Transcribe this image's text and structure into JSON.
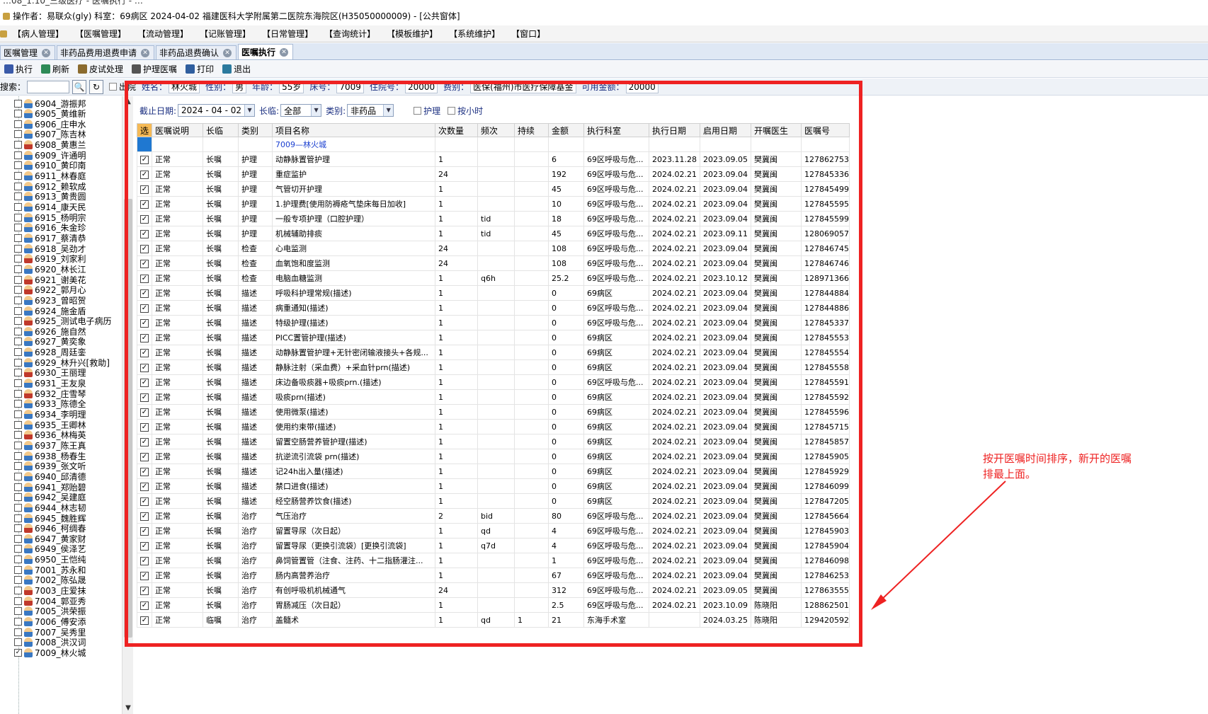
{
  "window": {
    "title_fragment": "…08_1.10_三级医疗 - 医嘱执行 - …",
    "operator_line": "操作者：易联众(gly)  科室：69病区  2024-04-02  福建医科大学附属第二医院东海院区(H35050000009) - [公共窗体]"
  },
  "menu": [
    "【病人管理】",
    "【医嘱管理】",
    "【流动管理】",
    "【记账管理】",
    "【日常管理】",
    "【查询统计】",
    "【模板维护】",
    "【系统维护】",
    "【窗口】"
  ],
  "tabs": [
    {
      "label": "医嘱管理",
      "active": false
    },
    {
      "label": "非药品费用退费申请",
      "active": false
    },
    {
      "label": "非药品退费确认",
      "active": false
    },
    {
      "label": "医嘱执行",
      "active": true
    }
  ],
  "toolbar": [
    {
      "label": "执行",
      "icon": "execute-icon",
      "color": "#3a5aa8"
    },
    {
      "label": "刷新",
      "icon": "refresh-icon",
      "color": "#2e8b57"
    },
    {
      "label": "皮试处理",
      "icon": "syringe-icon",
      "color": "#8b6b2e"
    },
    {
      "label": "护理医嘱",
      "icon": "nursing-icon",
      "color": "#555555"
    },
    {
      "label": "打印",
      "icon": "printer-icon",
      "color": "#2f5e9e"
    },
    {
      "label": "退出",
      "icon": "exit-icon",
      "color": "#2c7a9e"
    }
  ],
  "patientbar": {
    "search_label": "搜索：",
    "discharge_label": "出院",
    "fields": [
      {
        "label": "姓名：",
        "value": "林火城"
      },
      {
        "label": "性别：",
        "value": "男"
      },
      {
        "label": "年龄：",
        "value": "55岁"
      },
      {
        "label": "床号：",
        "value": "7009"
      },
      {
        "label": "住院号：",
        "value": "20000"
      },
      {
        "label": "费别：",
        "value": "医保(福州)市医疗保障基金"
      },
      {
        "label": "可用金额：",
        "value": "20000"
      }
    ]
  },
  "patients": [
    {
      "id": "6904_游振邦",
      "female": false,
      "checked": false
    },
    {
      "id": "6905_黄维新",
      "female": false,
      "checked": false
    },
    {
      "id": "6906_庄申水",
      "female": false,
      "checked": false
    },
    {
      "id": "6907_陈吉林",
      "female": false,
      "checked": false
    },
    {
      "id": "6908_黄惠兰",
      "female": true,
      "checked": false
    },
    {
      "id": "6909_许通明",
      "female": false,
      "checked": false
    },
    {
      "id": "6910_黄印南",
      "female": false,
      "checked": false
    },
    {
      "id": "6911_林春庭",
      "female": false,
      "checked": false
    },
    {
      "id": "6912_赖软成",
      "female": false,
      "checked": false
    },
    {
      "id": "6913_黄贵圆",
      "female": false,
      "checked": false
    },
    {
      "id": "6914_康天民",
      "female": false,
      "checked": false
    },
    {
      "id": "6915_杨明宗",
      "female": false,
      "checked": false
    },
    {
      "id": "6916_朱金珍",
      "female": false,
      "checked": false
    },
    {
      "id": "6917_蔡清恭",
      "female": false,
      "checked": false
    },
    {
      "id": "6918_吴劲才",
      "female": false,
      "checked": false
    },
    {
      "id": "6919_刘家利",
      "female": true,
      "checked": false
    },
    {
      "id": "6920_林长江",
      "female": false,
      "checked": false
    },
    {
      "id": "6921_谢美花",
      "female": true,
      "checked": false
    },
    {
      "id": "6922_郭月心",
      "female": true,
      "checked": false
    },
    {
      "id": "6923_曾昭贺",
      "female": false,
      "checked": false
    },
    {
      "id": "6924_施金盾",
      "female": false,
      "checked": false
    },
    {
      "id": "6925_测试电子病历",
      "female": true,
      "checked": false
    },
    {
      "id": "6926_施自然",
      "female": false,
      "checked": false
    },
    {
      "id": "6927_黄奕象",
      "female": false,
      "checked": false
    },
    {
      "id": "6928_周廷銮",
      "female": false,
      "checked": false
    },
    {
      "id": "6929_林升兴[救助]",
      "female": false,
      "checked": false
    },
    {
      "id": "6930_王丽理",
      "female": true,
      "checked": false
    },
    {
      "id": "6931_王友泉",
      "female": false,
      "checked": false
    },
    {
      "id": "6932_庄雪琴",
      "female": true,
      "checked": false
    },
    {
      "id": "6933_陈德全",
      "female": false,
      "checked": false
    },
    {
      "id": "6934_李明理",
      "female": false,
      "checked": false
    },
    {
      "id": "6935_王卿林",
      "female": false,
      "checked": false
    },
    {
      "id": "6936_林梅英",
      "female": true,
      "checked": false
    },
    {
      "id": "6937_陈王真",
      "female": false,
      "checked": false
    },
    {
      "id": "6938_杨春生",
      "female": false,
      "checked": false
    },
    {
      "id": "6939_张文听",
      "female": false,
      "checked": false
    },
    {
      "id": "6940_邱清德",
      "female": false,
      "checked": false
    },
    {
      "id": "6941_郑贻碧",
      "female": false,
      "checked": false
    },
    {
      "id": "6942_吴建庭",
      "female": false,
      "checked": false
    },
    {
      "id": "6944_林志韧",
      "female": false,
      "checked": false
    },
    {
      "id": "6945_魏胜辉",
      "female": false,
      "checked": false
    },
    {
      "id": "6946_柯绸春",
      "female": true,
      "checked": false
    },
    {
      "id": "6947_黄家财",
      "female": false,
      "checked": false
    },
    {
      "id": "6949_侯泽艺",
      "female": false,
      "checked": false
    },
    {
      "id": "6950_王恺纯",
      "female": false,
      "checked": false
    },
    {
      "id": "7001_苏永和",
      "female": false,
      "checked": false
    },
    {
      "id": "7002_陈弘晟",
      "female": false,
      "checked": false
    },
    {
      "id": "7003_庄爱抹",
      "female": true,
      "checked": false
    },
    {
      "id": "7004_郭亚秀",
      "female": true,
      "checked": false
    },
    {
      "id": "7005_洪荣振",
      "female": false,
      "checked": false
    },
    {
      "id": "7006_傅安添",
      "female": false,
      "checked": false
    },
    {
      "id": "7007_吴秀里",
      "female": false,
      "checked": false
    },
    {
      "id": "7008_洪汉词",
      "female": false,
      "checked": false
    },
    {
      "id": "7009_林火城",
      "female": false,
      "checked": true
    }
  ],
  "filters": {
    "end_date_label": "截止日期:",
    "end_date_value": "2024 - 04 - 02",
    "long_temp_label": "长临:",
    "long_temp_value": "全部",
    "category_label": "类别:",
    "category_value": "非药品",
    "nursing_label": "护理",
    "by_hour_label": "按小时"
  },
  "grid": {
    "headers": [
      "选",
      "医嘱说明",
      "长临",
      "类别",
      "项目名称",
      "次数量",
      "频次",
      "持续",
      "金额",
      "执行科室",
      "执行日期",
      "启用日期",
      "开嘱医生",
      "医嘱号"
    ],
    "group_label": "7009—林火城",
    "rows": [
      [
        "正常",
        "长嘱",
        "护理",
        "动静脉置管护理",
        "1",
        "",
        "",
        "6",
        "69区呼吸与危...",
        "2023.11.28",
        "2023.09.05",
        "樊冀闽",
        "127862753"
      ],
      [
        "正常",
        "长嘱",
        "护理",
        "重症监护",
        "24",
        "",
        "",
        "192",
        "69区呼吸与危...",
        "2024.02.21",
        "2023.09.04",
        "樊冀闽",
        "127845336"
      ],
      [
        "正常",
        "长嘱",
        "护理",
        "气管切开护理",
        "1",
        "",
        "",
        "45",
        "69区呼吸与危...",
        "2024.02.21",
        "2023.09.04",
        "樊冀闽",
        "127845499"
      ],
      [
        "正常",
        "长嘱",
        "护理",
        "1.护理费[使用防褥疮气垫床每日加收]",
        "1",
        "",
        "",
        "10",
        "69区呼吸与危...",
        "2024.02.21",
        "2023.09.04",
        "樊冀闽",
        "127845595"
      ],
      [
        "正常",
        "长嘱",
        "护理",
        "一般专项护理（口腔护理）",
        "1",
        "tid",
        "",
        "18",
        "69区呼吸与危...",
        "2024.02.21",
        "2023.09.04",
        "樊冀闽",
        "127845599"
      ],
      [
        "正常",
        "长嘱",
        "护理",
        "机械辅助排痰",
        "1",
        "tid",
        "",
        "45",
        "69区呼吸与危...",
        "2024.02.21",
        "2023.09.11",
        "樊冀闽",
        "128069057"
      ],
      [
        "正常",
        "长嘱",
        "检查",
        "心电监测",
        "24",
        "",
        "",
        "108",
        "69区呼吸与危...",
        "2024.02.21",
        "2023.09.04",
        "樊冀闽",
        "127846745"
      ],
      [
        "正常",
        "长嘱",
        "检查",
        "血氧饱和度监测",
        "24",
        "",
        "",
        "108",
        "69区呼吸与危...",
        "2024.02.21",
        "2023.09.04",
        "樊冀闽",
        "127846746"
      ],
      [
        "正常",
        "长嘱",
        "检查",
        "电脑血糖监测",
        "1",
        "q6h",
        "",
        "25.2",
        "69区呼吸与危...",
        "2024.02.21",
        "2023.10.12",
        "樊冀闽",
        "128971366"
      ],
      [
        "正常",
        "长嘱",
        "描述",
        "呼吸科护理常规(描述)",
        "1",
        "",
        "",
        "0",
        "69病区",
        "2024.02.21",
        "2023.09.04",
        "樊冀闽",
        "127844884"
      ],
      [
        "正常",
        "长嘱",
        "描述",
        "病重通知(描述)",
        "1",
        "",
        "",
        "0",
        "69区呼吸与危...",
        "2024.02.21",
        "2023.09.04",
        "樊冀闽",
        "127844886"
      ],
      [
        "正常",
        "长嘱",
        "描述",
        "特级护理(描述)",
        "1",
        "",
        "",
        "0",
        "69区呼吸与危...",
        "2024.02.21",
        "2023.09.04",
        "樊冀闽",
        "127845337"
      ],
      [
        "正常",
        "长嘱",
        "描述",
        "PICC置管护理(描述)",
        "1",
        "",
        "",
        "0",
        "69病区",
        "2024.02.21",
        "2023.09.04",
        "樊冀闽",
        "127845553"
      ],
      [
        "正常",
        "长嘱",
        "描述",
        "动静脉置管护理+无针密闭输液接头+各规...",
        "1",
        "",
        "",
        "0",
        "69病区",
        "2024.02.21",
        "2023.09.04",
        "樊冀闽",
        "127845554"
      ],
      [
        "正常",
        "长嘱",
        "描述",
        "静脉注射（采血费）+采血针prn(描述)",
        "1",
        "",
        "",
        "0",
        "69病区",
        "2024.02.21",
        "2023.09.04",
        "樊冀闽",
        "127845558"
      ],
      [
        "正常",
        "长嘱",
        "描述",
        "床边备吸痰器+吸痰prn.(描述)",
        "1",
        "",
        "",
        "0",
        "69区呼吸与危...",
        "2024.02.21",
        "2023.09.04",
        "樊冀闽",
        "127845591"
      ],
      [
        "正常",
        "长嘱",
        "描述",
        "吸痰prn(描述)",
        "1",
        "",
        "",
        "0",
        "69病区",
        "2024.02.21",
        "2023.09.04",
        "樊冀闽",
        "127845592"
      ],
      [
        "正常",
        "长嘱",
        "描述",
        "使用微泵(描述)",
        "1",
        "",
        "",
        "0",
        "69病区",
        "2024.02.21",
        "2023.09.04",
        "樊冀闽",
        "127845596"
      ],
      [
        "正常",
        "长嘱",
        "描述",
        "使用约束带(描述)",
        "1",
        "",
        "",
        "0",
        "69病区",
        "2024.02.21",
        "2023.09.04",
        "樊冀闽",
        "127845715"
      ],
      [
        "正常",
        "长嘱",
        "描述",
        "留置空肠营养管护理(描述)",
        "1",
        "",
        "",
        "0",
        "69病区",
        "2024.02.21",
        "2023.09.04",
        "樊冀闽",
        "127845857"
      ],
      [
        "正常",
        "长嘱",
        "描述",
        "抗逆流引流袋 prn(描述)",
        "1",
        "",
        "",
        "0",
        "69病区",
        "2024.02.21",
        "2023.09.04",
        "樊冀闽",
        "127845905"
      ],
      [
        "正常",
        "长嘱",
        "描述",
        "记24h出入量(描述)",
        "1",
        "",
        "",
        "0",
        "69病区",
        "2024.02.21",
        "2023.09.04",
        "樊冀闽",
        "127845929"
      ],
      [
        "正常",
        "长嘱",
        "描述",
        "禁口进食(描述)",
        "1",
        "",
        "",
        "0",
        "69病区",
        "2024.02.21",
        "2023.09.04",
        "樊冀闽",
        "127846099"
      ],
      [
        "正常",
        "长嘱",
        "描述",
        "经空肠营养饮食(描述)",
        "1",
        "",
        "",
        "0",
        "69病区",
        "2024.02.21",
        "2023.09.04",
        "樊冀闽",
        "127847205"
      ],
      [
        "正常",
        "长嘱",
        "治疗",
        "气压治疗",
        "2",
        "bid",
        "",
        "80",
        "69区呼吸与危...",
        "2024.02.21",
        "2023.09.04",
        "樊冀闽",
        "127845664"
      ],
      [
        "正常",
        "长嘱",
        "治疗",
        "留置导尿（次日起）",
        "1",
        "qd",
        "",
        "4",
        "69区呼吸与危...",
        "2024.02.21",
        "2023.09.04",
        "樊冀闽",
        "127845903"
      ],
      [
        "正常",
        "长嘱",
        "治疗",
        "留置导尿（更换引流袋）[更换引流袋]",
        "1",
        "q7d",
        "",
        "4",
        "69区呼吸与危...",
        "2024.02.21",
        "2023.09.04",
        "樊冀闽",
        "127845904"
      ],
      [
        "正常",
        "长嘱",
        "治疗",
        "鼻饲管置管（注食、注药、十二指肠灌注...",
        "1",
        "",
        "",
        "1",
        "69区呼吸与危...",
        "2024.02.21",
        "2023.09.04",
        "樊冀闽",
        "127846098"
      ],
      [
        "正常",
        "长嘱",
        "治疗",
        "肠内高营养治疗",
        "1",
        "",
        "",
        "67",
        "69区呼吸与危...",
        "2024.02.21",
        "2023.09.04",
        "樊冀闽",
        "127846253"
      ],
      [
        "正常",
        "长嘱",
        "治疗",
        "有创呼吸机机械通气",
        "24",
        "",
        "",
        "312",
        "69区呼吸与危...",
        "2024.02.21",
        "2023.09.05",
        "樊冀闽",
        "127863555"
      ],
      [
        "正常",
        "长嘱",
        "治疗",
        "胃肠减压（次日起）",
        "1",
        "",
        "",
        "2.5",
        "69区呼吸与危...",
        "2024.02.21",
        "2023.10.09",
        "陈晓阳",
        "128862501"
      ],
      [
        "正常",
        "临嘱",
        "治疗",
        "盖髓术",
        "1",
        "qd",
        "1",
        "21",
        "东海手术室",
        "",
        "2024.03.25",
        "陈晓阳",
        "129420592"
      ]
    ]
  },
  "annotation": {
    "text": "按开医嘱时间排序，新开的医嘱排最上面。",
    "color": "#ee2222"
  }
}
